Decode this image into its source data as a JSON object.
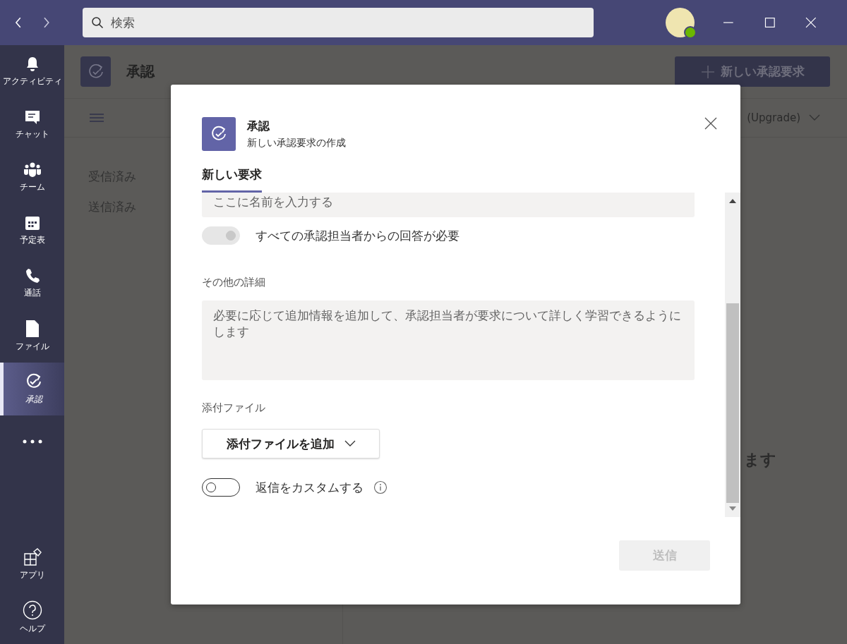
{
  "search": {
    "placeholder": "検索"
  },
  "sidebar": {
    "items": [
      {
        "kind": "bell",
        "label": "アクティビティ",
        "selected": false
      },
      {
        "kind": "chat",
        "label": "チャット",
        "selected": false
      },
      {
        "kind": "team",
        "label": "チーム",
        "selected": false
      },
      {
        "kind": "calendar",
        "label": "予定表",
        "selected": false
      },
      {
        "kind": "phone",
        "label": "通話",
        "selected": false
      },
      {
        "kind": "file",
        "label": "ファイル",
        "selected": false
      },
      {
        "kind": "approval",
        "label": "承認",
        "selected": true
      }
    ],
    "bottom_items": [
      {
        "kind": "apps",
        "label": "アプリ"
      },
      {
        "kind": "help",
        "label": "ヘルプ"
      }
    ]
  },
  "app_header": {
    "title": "承認",
    "new_button": "新しい承認要求"
  },
  "toolbar": {
    "plan_label": "(Upgrade)"
  },
  "nav_list": [
    {
      "label": "受信済み"
    },
    {
      "label": "送信済み"
    }
  ],
  "background_text": "ます",
  "dialog": {
    "app_name": "承認",
    "subtitle": "新しい承認要求の作成",
    "tabs": [
      {
        "label": "新しい要求",
        "selected": true
      }
    ],
    "name_field": {
      "placeholder": "ここに名前を入力する"
    },
    "require_all": {
      "label": "すべての承認担当者からの回答が必要",
      "on": true,
      "disabled": true
    },
    "details": {
      "label": "その他の詳細",
      "placeholder": "必要に応じて追加情報を追加して、承認担当者が要求について詳しく学習できるようにします"
    },
    "attachments": {
      "label": "添付ファイル",
      "button": "添付ファイルを追加"
    },
    "custom_responses": {
      "label": "返信をカスタムする",
      "on": false,
      "disabled": false
    },
    "send_button": {
      "label": "送信",
      "disabled": true
    }
  }
}
